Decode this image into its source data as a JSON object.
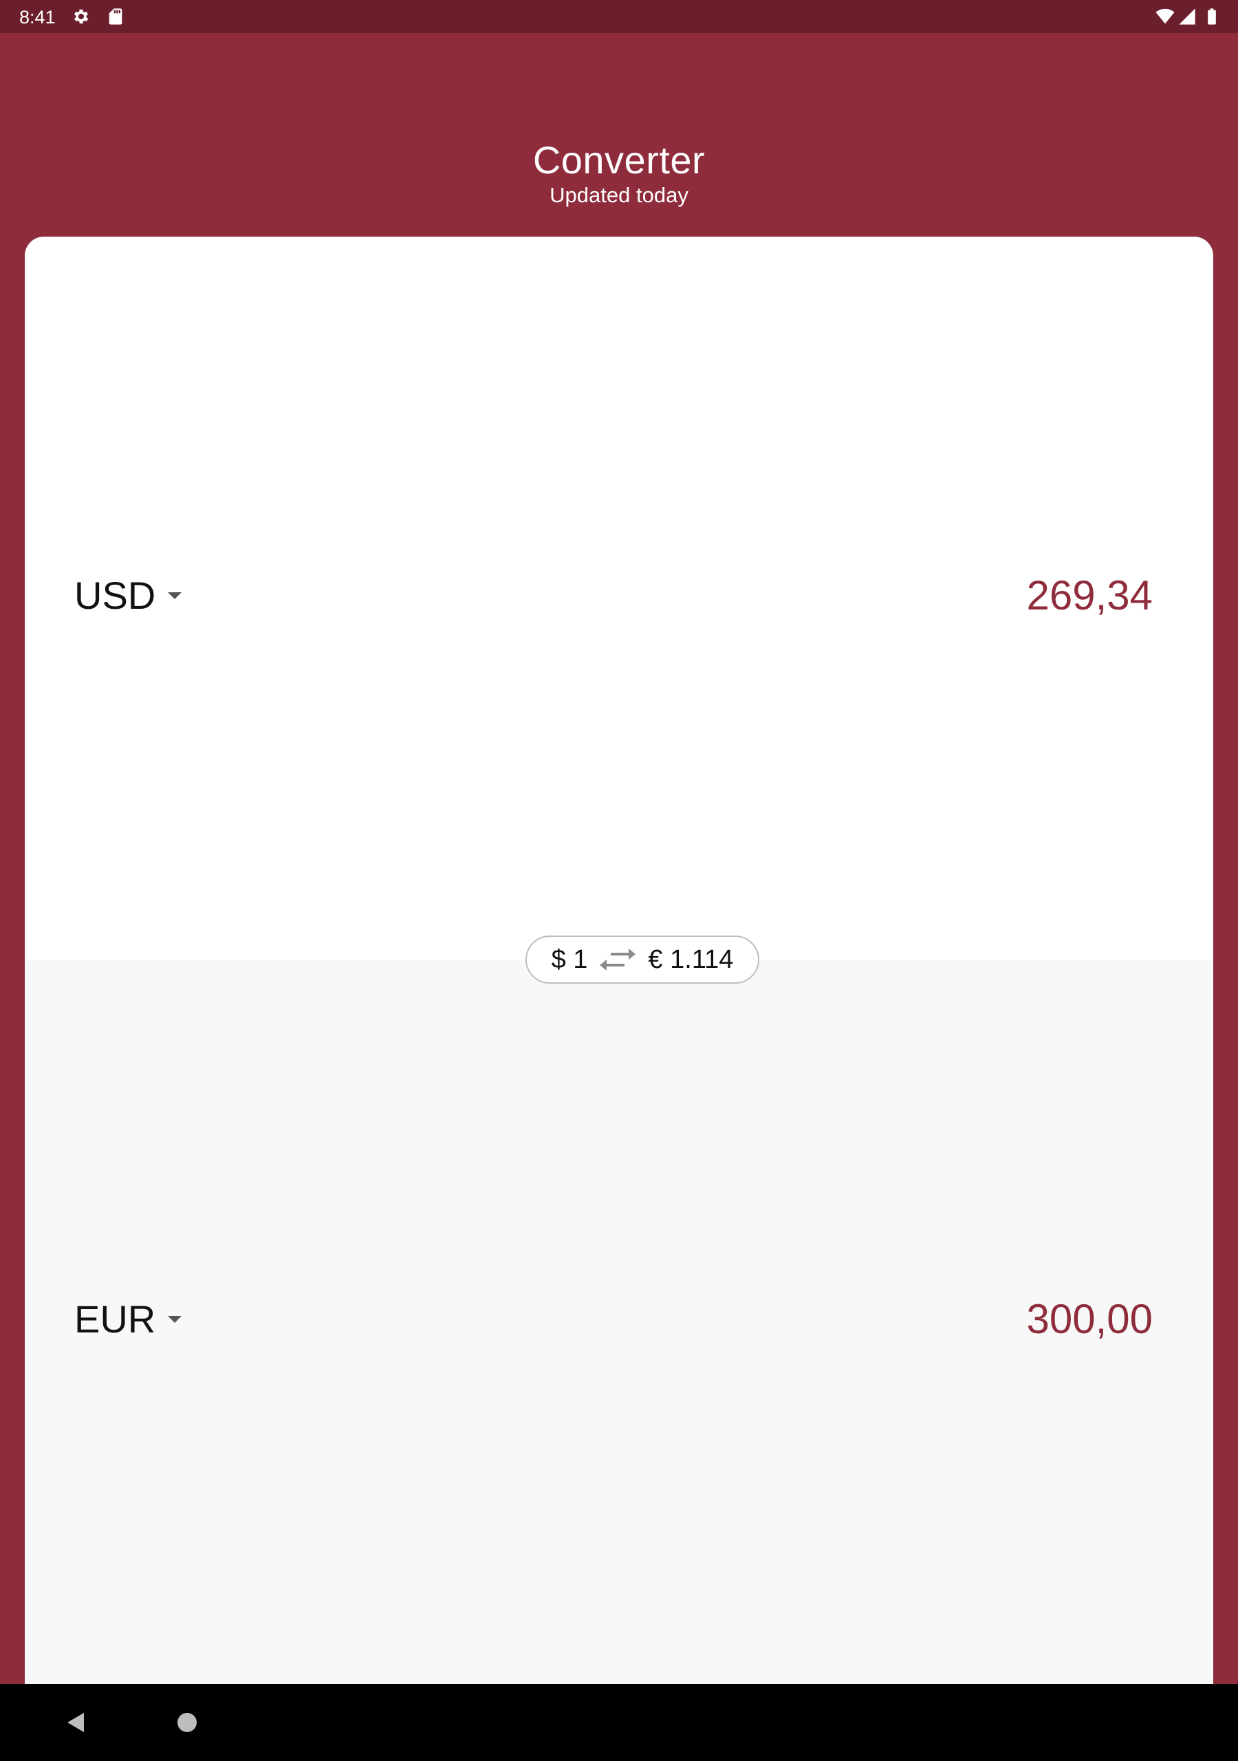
{
  "status_bar": {
    "time": "8:41",
    "icons": [
      "settings-icon",
      "sd-card-icon",
      "wifi-icon",
      "cell-signal-icon",
      "battery-icon"
    ]
  },
  "app_bar": {
    "title": "Converter",
    "subtitle": "Updated today"
  },
  "converter": {
    "top": {
      "currency": "USD",
      "amount": "269,34"
    },
    "bottom": {
      "currency": "EUR",
      "amount": "300,00"
    },
    "rate": {
      "from": "$ 1",
      "to": "€ 1.114",
      "icon": "swap-arrows-icon"
    }
  },
  "nav_bar": {
    "icons": [
      "back-icon",
      "home-icon"
    ]
  },
  "colors": {
    "primary": "#8e2c3c",
    "status_bar": "#6b1f2c",
    "amount_text": "#8e2c3c",
    "bottom_pane": "#f8f8f9"
  }
}
